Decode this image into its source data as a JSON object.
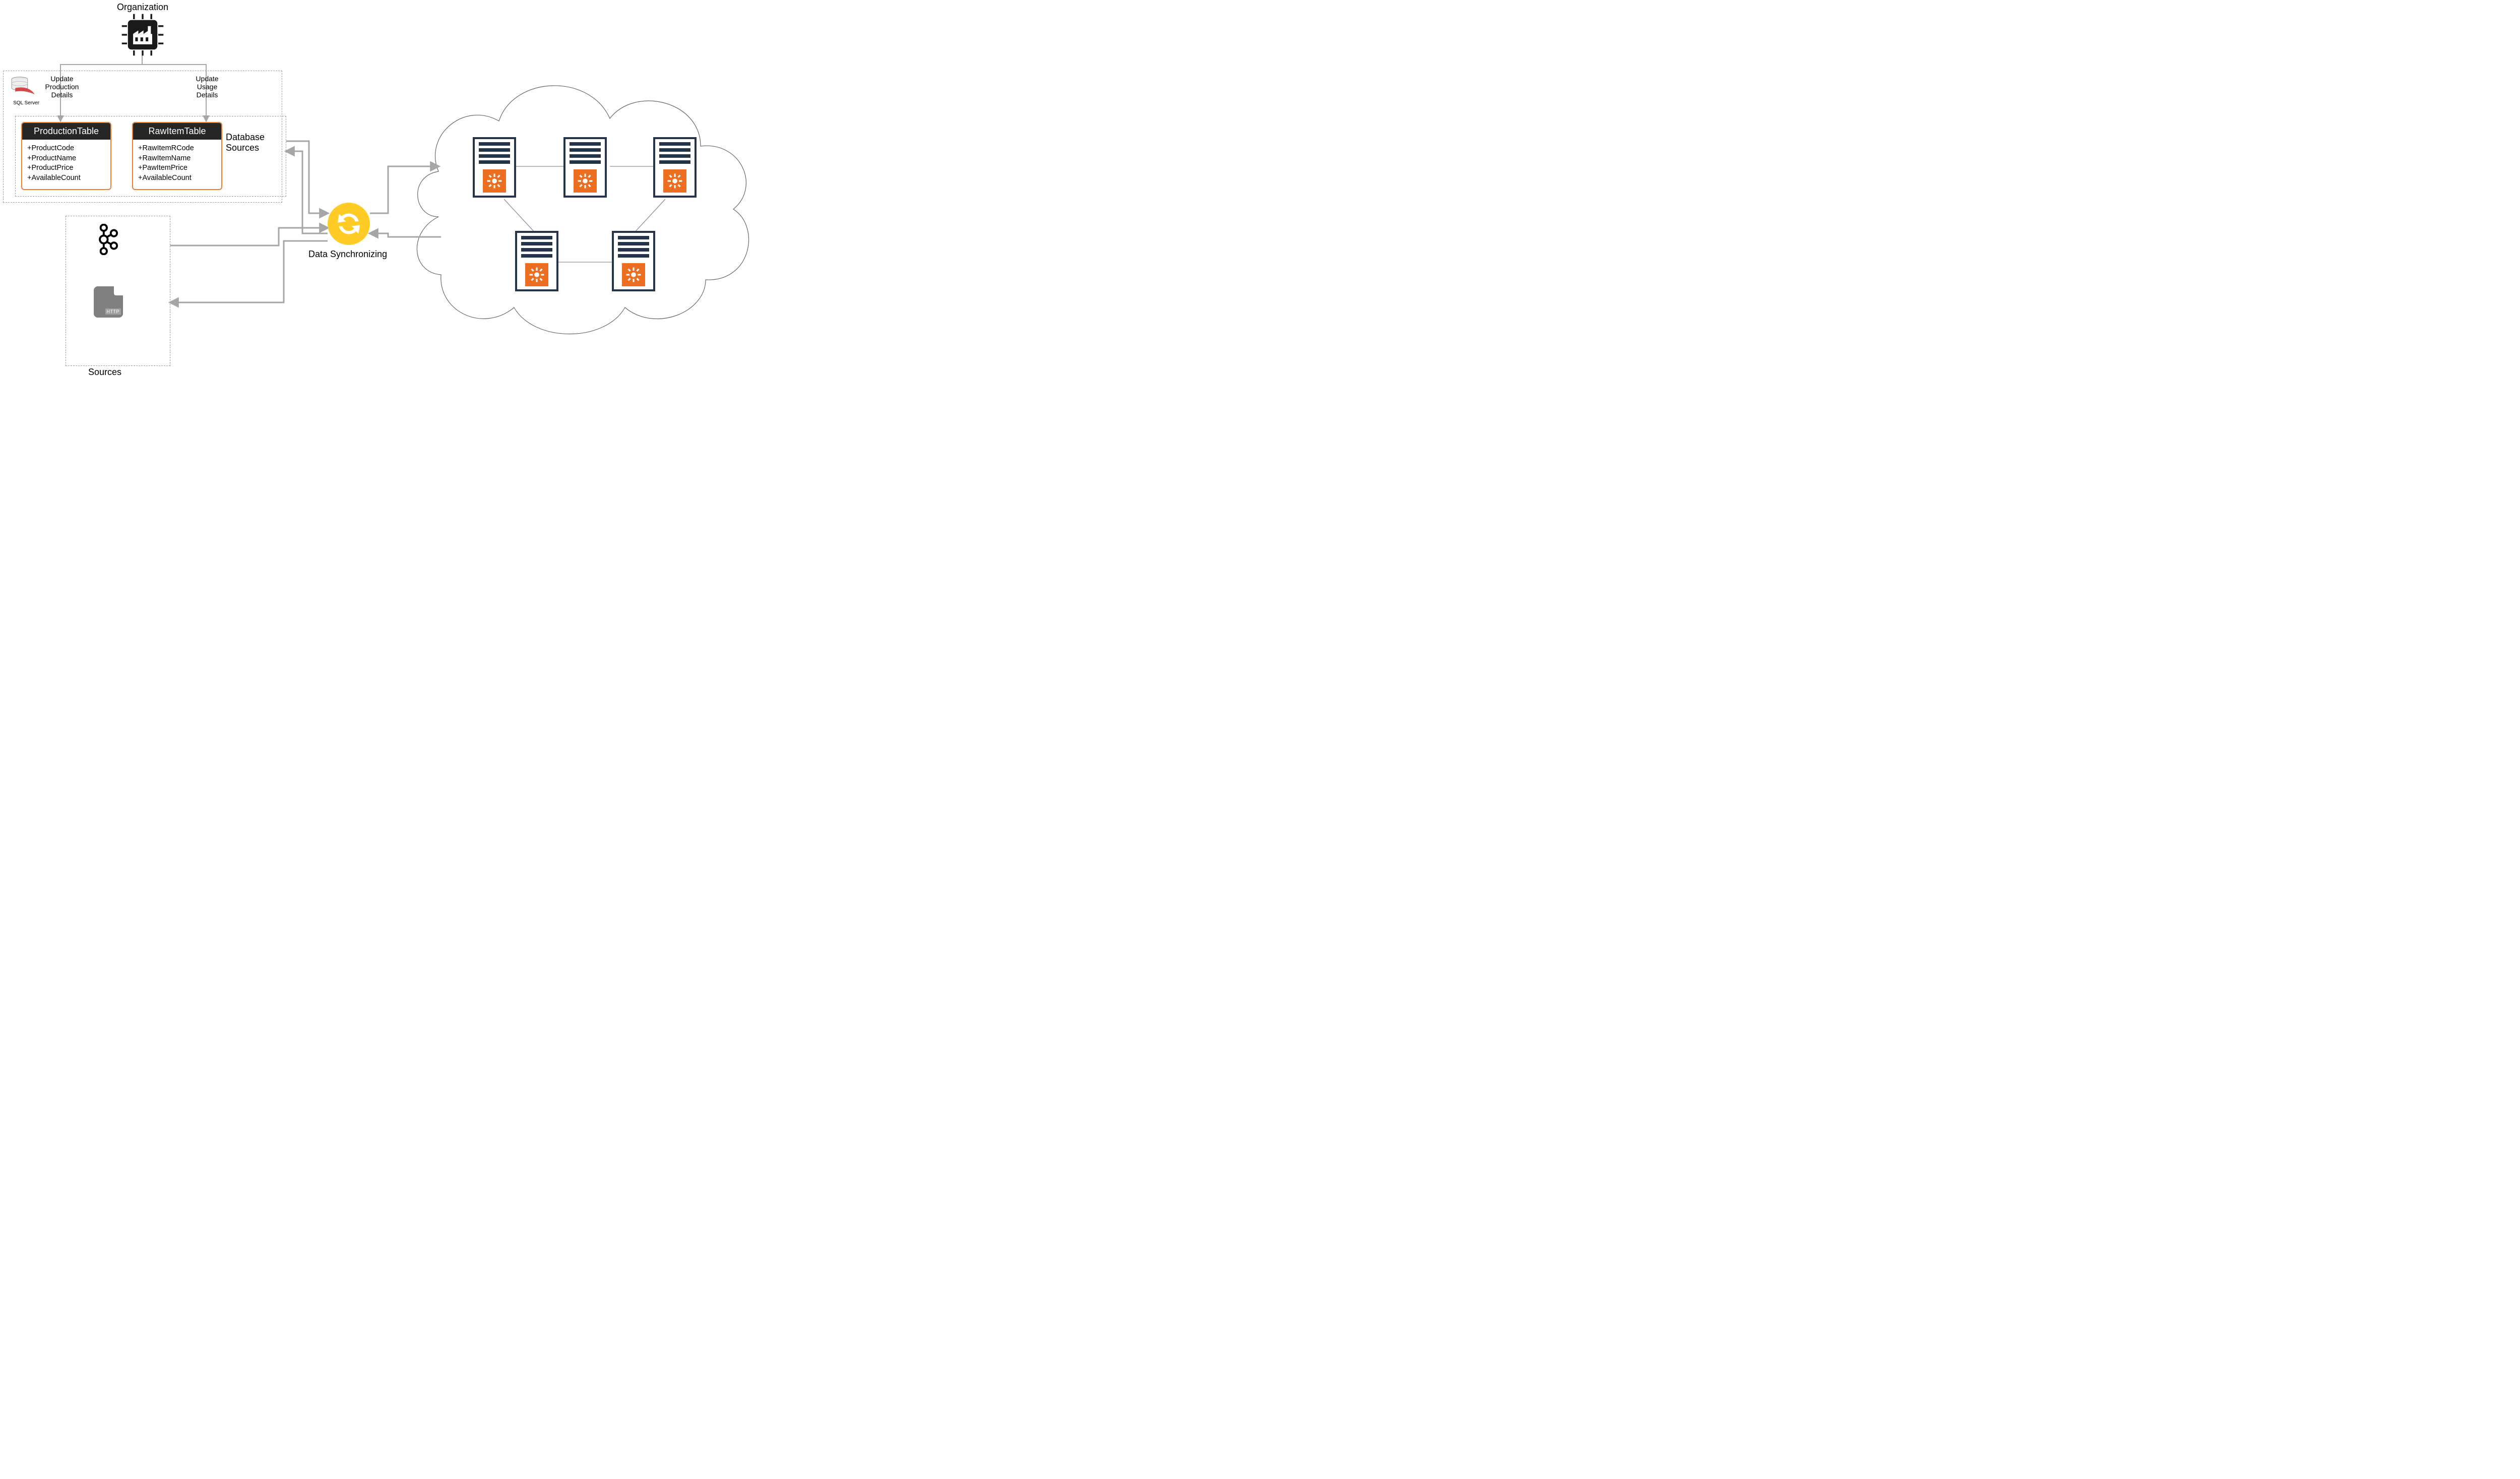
{
  "labels": {
    "organization": "Organization",
    "sqlserver_sub": "SQL Server",
    "update_production": "Update\nProduction\nDetails",
    "update_usage": "Update\nUsage\nDetails",
    "database_sources": "Database\nSources",
    "data_sync": "Data Synchronizing",
    "sources": "Sources",
    "http": "HTTP"
  },
  "tables": {
    "production": {
      "title": "ProductionTable",
      "fields": [
        "+ProductCode",
        "+ProductName",
        "+ProductPrice",
        "+AvailableCount"
      ]
    },
    "rawitem": {
      "title": "RawItemTable",
      "fields": [
        "+RawItemRCode",
        "+RawItemName",
        "+PawItemPrice",
        "+AvailableCount"
      ]
    }
  },
  "icons": {
    "factory_chip": "factory-chip-icon",
    "sqlserver": "sqlserver-icon",
    "kafka": "kafka-icon",
    "http_doc": "http-file-icon",
    "sync": "sync-icon",
    "cloud": "cloud-icon",
    "server": "server-icon",
    "gear": "gear-icon"
  },
  "colors": {
    "accent_orange": "#ed7d31",
    "server_orange": "#ec6e21",
    "sync_yellow": "#ffcc26",
    "dark": "#262626",
    "navy": "#263447",
    "dash_gray": "#9aa0a6",
    "arrow_gray": "#a6a6a6"
  }
}
